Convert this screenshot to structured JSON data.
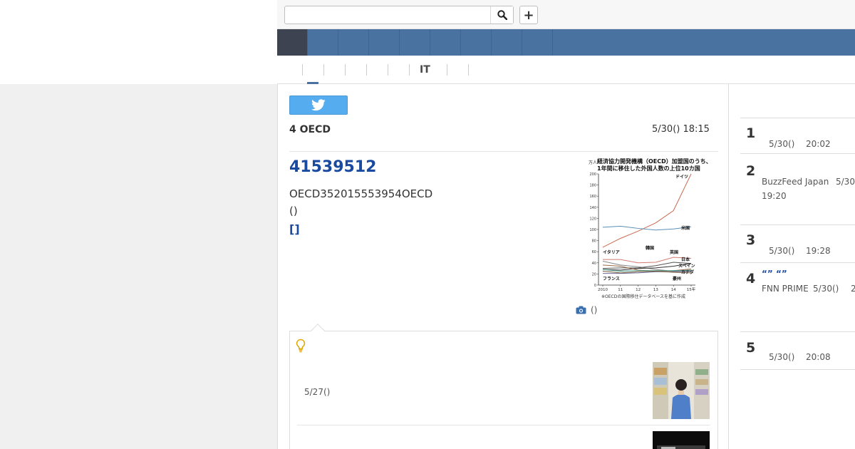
{
  "header": {
    "search_placeholder": "",
    "search_value": "",
    "plus_label": "+"
  },
  "subnav": {
    "items": [
      "",
      "",
      "",
      "",
      "",
      "IT",
      "",
      ""
    ]
  },
  "article": {
    "source": "4 OECD",
    "date": "5/30() 18:15",
    "headline": "41539512",
    "body_line1": "OECD352015553954OECD",
    "body_line2": "()",
    "more_link": "[]",
    "photo_credit": "()"
  },
  "chart_data": {
    "type": "line",
    "title": "経済協力開発機構（OECD）加盟国のうち、1年間に移住した外国人数の上位10カ国",
    "ylabel": "万人",
    "x": [
      "2010",
      "11",
      "12",
      "13",
      "14",
      "15年"
    ],
    "ylim": [
      0,
      200
    ],
    "yticks": [
      0,
      20,
      40,
      60,
      80,
      100,
      120,
      140,
      160,
      180,
      200
    ],
    "note": "※OECDの国際移住データベースを基に作成",
    "series": [
      {
        "name": "ドイツ",
        "values": [
          68,
          84,
          97,
          112,
          134,
          200
        ],
        "color": "#c86a50"
      },
      {
        "name": "米国",
        "values": [
          104,
          106,
          102,
          99,
          101,
          105
        ],
        "color": "#5a90b8"
      },
      {
        "name": "イタリア",
        "values": [
          43,
          36,
          33,
          28,
          25,
          26
        ],
        "color": "#888888"
      },
      {
        "name": "韓国",
        "values": [
          30,
          31,
          31,
          35,
          41,
          39
        ],
        "color": "#555555"
      },
      {
        "name": "英国",
        "values": [
          46,
          46,
          40,
          41,
          50,
          48
        ],
        "color": "#d47a70"
      },
      {
        "name": "日本",
        "values": [
          28,
          27,
          30,
          31,
          34,
          39
        ],
        "color": "#333333"
      },
      {
        "name": "スペイン",
        "values": [
          36,
          34,
          27,
          25,
          26,
          29
        ],
        "color": "#9a6a4a"
      },
      {
        "name": "カナダ",
        "values": [
          28,
          25,
          26,
          26,
          26,
          27
        ],
        "color": "#4a9a8a"
      },
      {
        "name": "フランス",
        "values": [
          21,
          21,
          22,
          24,
          24,
          25
        ],
        "color": "#6a6a9a"
      },
      {
        "name": "豪州",
        "values": [
          25,
          22,
          24,
          25,
          23,
          22
        ],
        "color": "#7a5a3a"
      }
    ]
  },
  "related": {
    "date": "5/27()"
  },
  "ranking": {
    "items": [
      {
        "num": "1",
        "date": "5/30()",
        "time": "20:02",
        "source": "",
        "link": ""
      },
      {
        "num": "2",
        "date": "5/30",
        "time": "19:20",
        "source": "BuzzFeed Japan",
        "link": ""
      },
      {
        "num": "3",
        "date": "5/30()",
        "time": "19:28",
        "source": "",
        "link": ""
      },
      {
        "num": "4",
        "date": "5/30()",
        "time": "2",
        "source": "FNN PRIME",
        "link": "“” “”"
      },
      {
        "num": "5",
        "date": "5/30()",
        "time": "20:08",
        "source": "",
        "link": ""
      }
    ]
  },
  "colors": {
    "nav": "#4a72a1",
    "nav_active": "#3d4350",
    "link": "#1a4aa0",
    "twitter": "#55acee"
  }
}
